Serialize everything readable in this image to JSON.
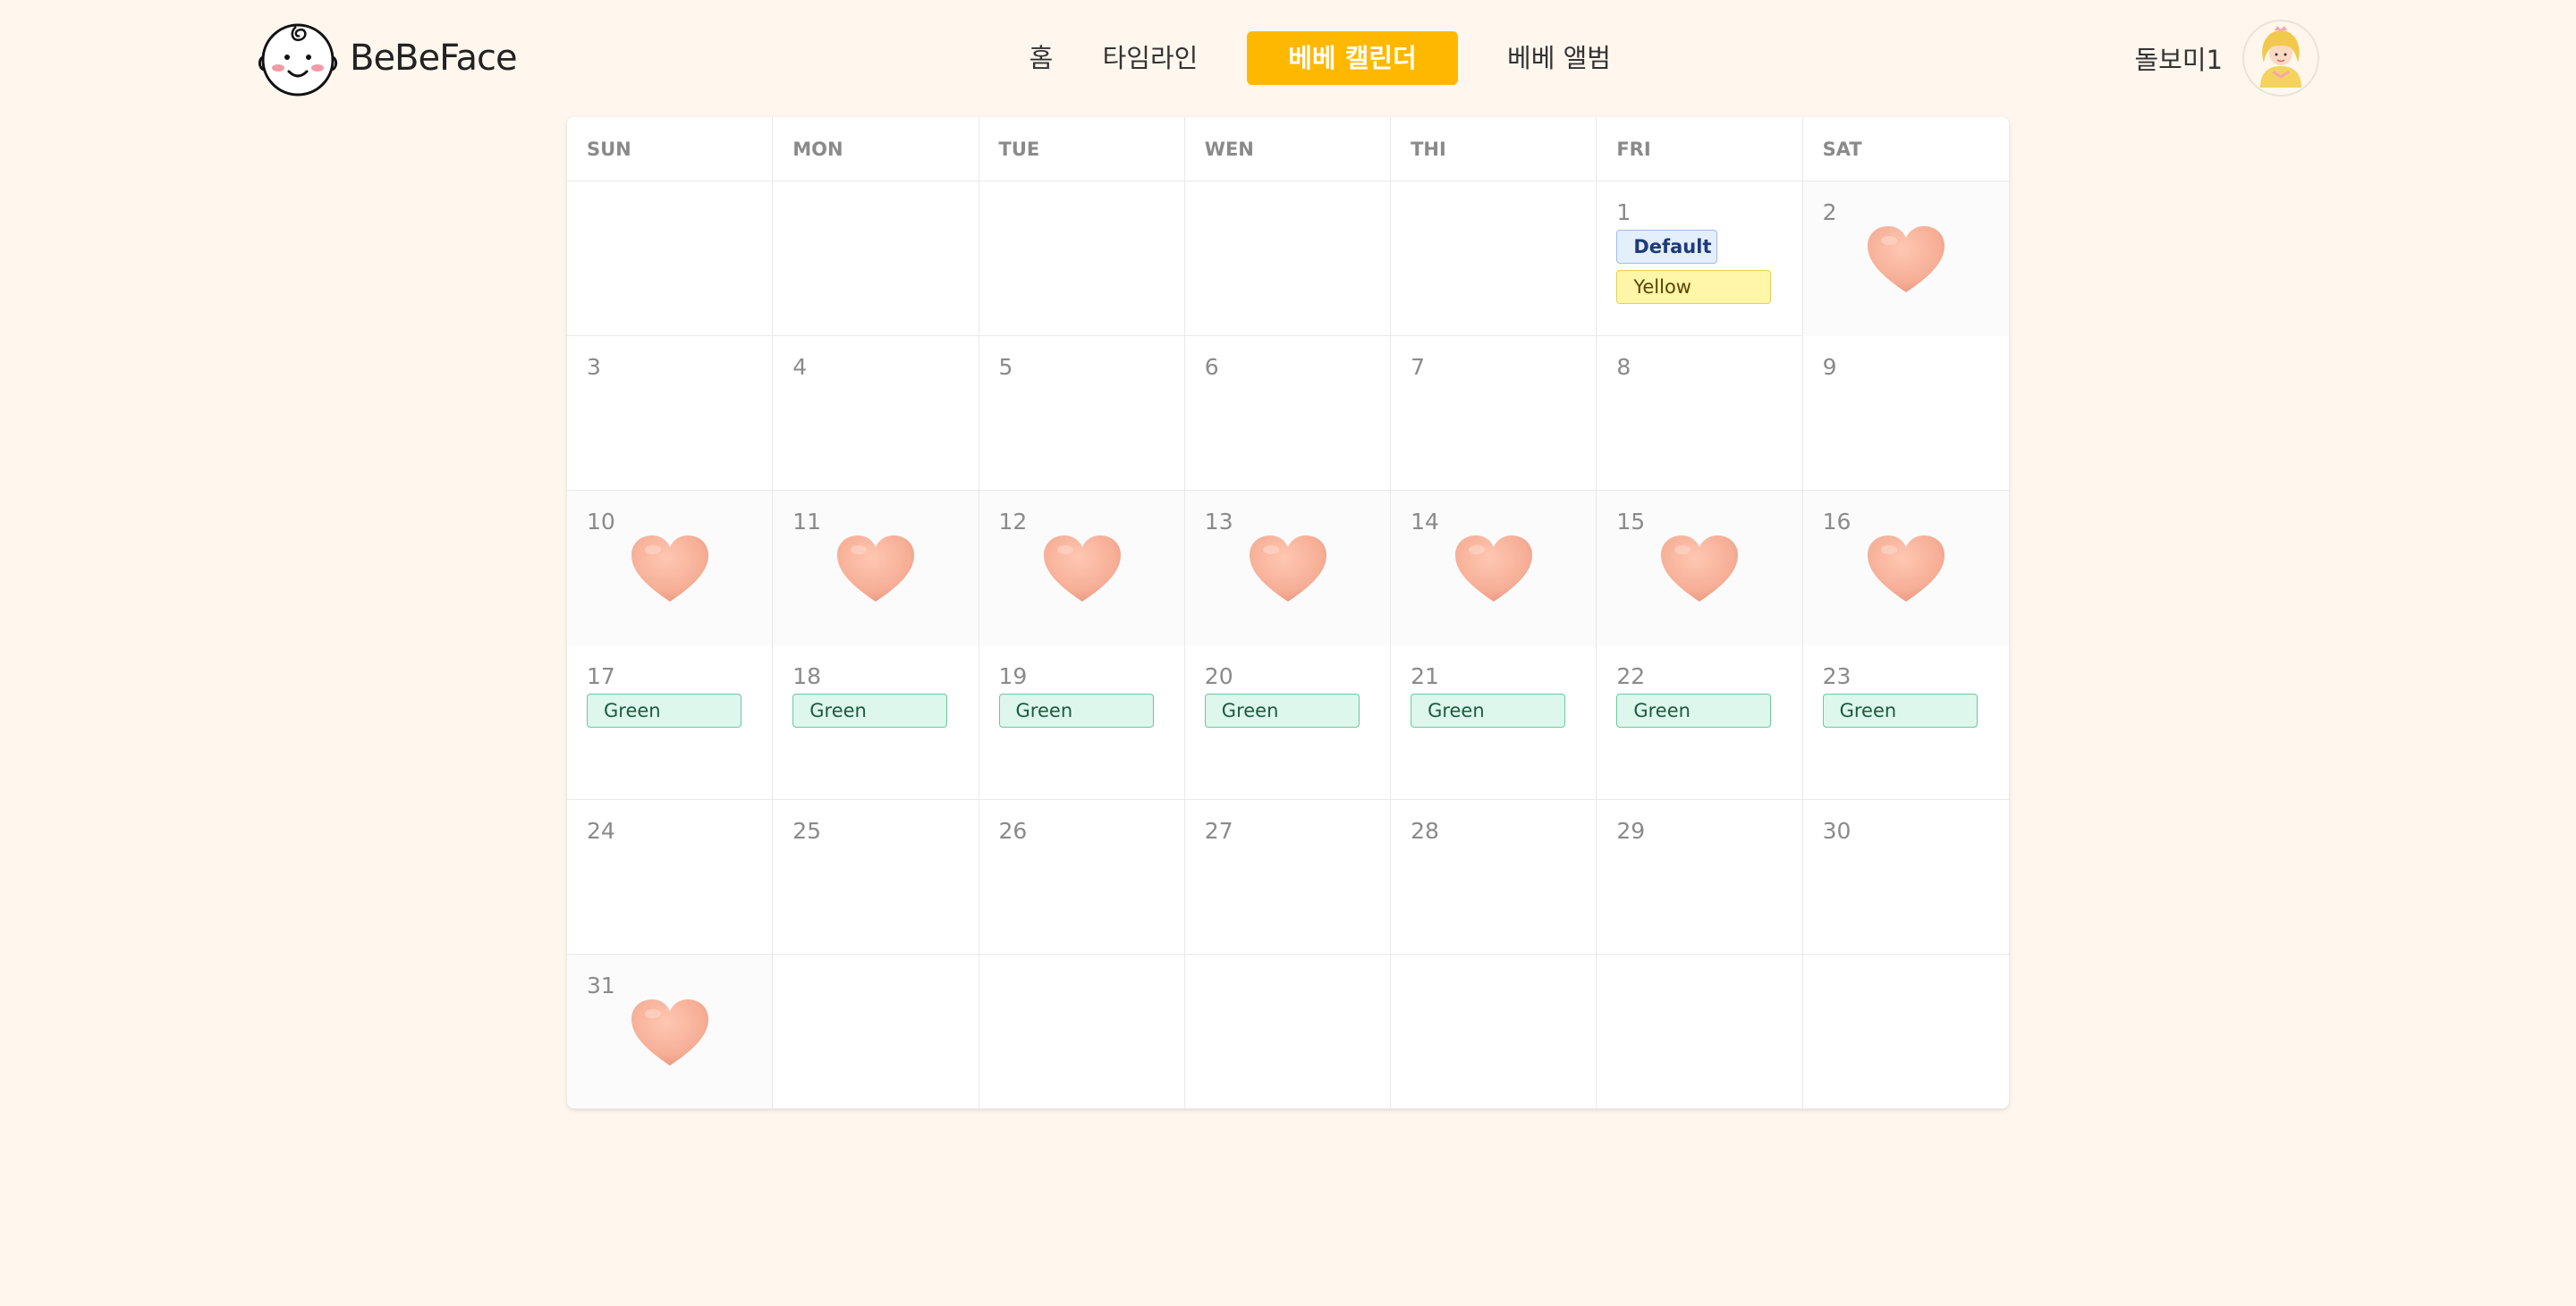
{
  "app": {
    "logo_text": "BeBeFace"
  },
  "nav": {
    "home": "홈",
    "timeline": "타임라인",
    "calendar": "베베 캘린더",
    "album": "베베 앨범"
  },
  "user": {
    "name": "돌보미1"
  },
  "colors": {
    "accent": "#FFB800",
    "background": "#FFF7EE",
    "heart": "#F9B29C"
  },
  "calendar": {
    "weekdays": [
      "SUN",
      "MON",
      "TUE",
      "WEN",
      "THI",
      "FRI",
      "SAT"
    ],
    "weeks": [
      [
        {
          "day": "",
          "heart": false,
          "events": []
        },
        {
          "day": "",
          "heart": false,
          "events": []
        },
        {
          "day": "",
          "heart": false,
          "events": []
        },
        {
          "day": "",
          "heart": false,
          "events": []
        },
        {
          "day": "",
          "heart": false,
          "events": []
        },
        {
          "day": "1",
          "heart": false,
          "events": [
            {
              "label": "Default",
              "style": "default"
            },
            {
              "label": "Yellow",
              "style": "yellow"
            }
          ]
        },
        {
          "day": "2",
          "heart": true,
          "events": []
        }
      ],
      [
        {
          "day": "3",
          "heart": false,
          "events": []
        },
        {
          "day": "4",
          "heart": false,
          "events": []
        },
        {
          "day": "5",
          "heart": false,
          "events": []
        },
        {
          "day": "6",
          "heart": false,
          "events": []
        },
        {
          "day": "7",
          "heart": false,
          "events": []
        },
        {
          "day": "8",
          "heart": false,
          "events": []
        },
        {
          "day": "9",
          "heart": false,
          "events": []
        }
      ],
      [
        {
          "day": "10",
          "heart": true,
          "events": []
        },
        {
          "day": "11",
          "heart": true,
          "events": []
        },
        {
          "day": "12",
          "heart": true,
          "events": []
        },
        {
          "day": "13",
          "heart": true,
          "events": []
        },
        {
          "day": "14",
          "heart": true,
          "events": []
        },
        {
          "day": "15",
          "heart": true,
          "events": []
        },
        {
          "day": "16",
          "heart": true,
          "events": []
        }
      ],
      [
        {
          "day": "17",
          "heart": false,
          "events": [
            {
              "label": "Green",
              "style": "green"
            }
          ]
        },
        {
          "day": "18",
          "heart": false,
          "events": [
            {
              "label": "Green",
              "style": "green"
            }
          ]
        },
        {
          "day": "19",
          "heart": false,
          "events": [
            {
              "label": "Green",
              "style": "green"
            }
          ]
        },
        {
          "day": "20",
          "heart": false,
          "events": [
            {
              "label": "Green",
              "style": "green"
            }
          ]
        },
        {
          "day": "21",
          "heart": false,
          "events": [
            {
              "label": "Green",
              "style": "green"
            }
          ]
        },
        {
          "day": "22",
          "heart": false,
          "events": [
            {
              "label": "Green",
              "style": "green"
            }
          ]
        },
        {
          "day": "23",
          "heart": false,
          "events": [
            {
              "label": "Green",
              "style": "green"
            }
          ]
        }
      ],
      [
        {
          "day": "24",
          "heart": false,
          "events": []
        },
        {
          "day": "25",
          "heart": false,
          "events": []
        },
        {
          "day": "26",
          "heart": false,
          "events": []
        },
        {
          "day": "27",
          "heart": false,
          "events": []
        },
        {
          "day": "28",
          "heart": false,
          "events": []
        },
        {
          "day": "29",
          "heart": false,
          "events": []
        },
        {
          "day": "30",
          "heart": false,
          "events": []
        }
      ],
      [
        {
          "day": "31",
          "heart": true,
          "events": []
        },
        {
          "day": "",
          "heart": false,
          "events": []
        },
        {
          "day": "",
          "heart": false,
          "events": []
        },
        {
          "day": "",
          "heart": false,
          "events": []
        },
        {
          "day": "",
          "heart": false,
          "events": []
        },
        {
          "day": "",
          "heart": false,
          "events": []
        },
        {
          "day": "",
          "heart": false,
          "events": []
        }
      ]
    ]
  }
}
